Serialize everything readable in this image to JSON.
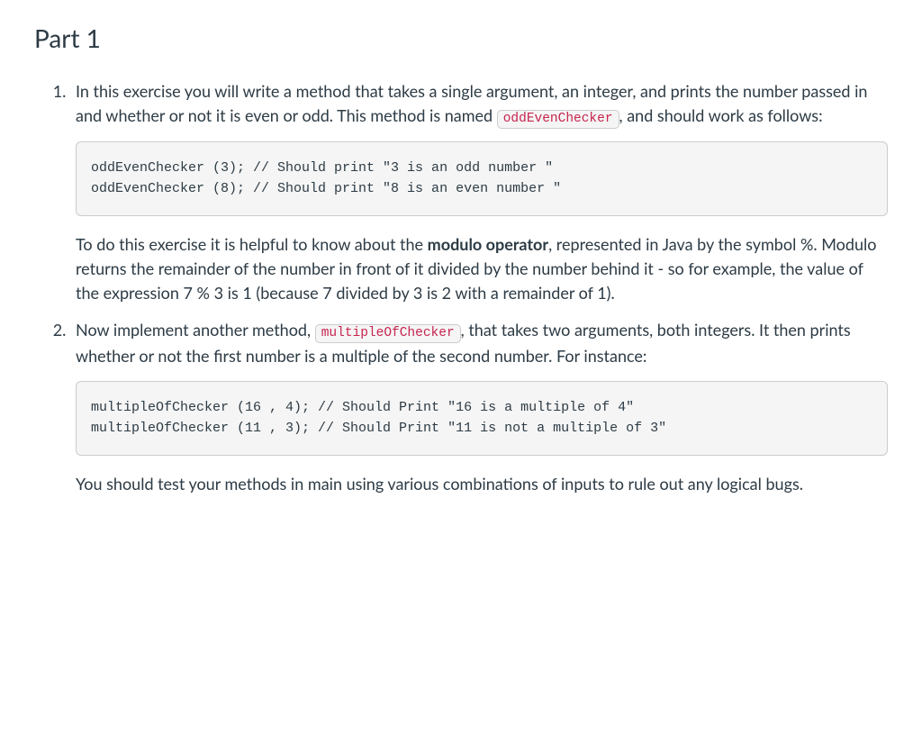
{
  "heading": "Part 1",
  "items": [
    {
      "intro_before_code": "In this exercise you will write a method that takes a single argument, an integer, and prints the number passed in and whether or not it is even or odd. This method is named ",
      "inline_code": "oddEvenChecker",
      "intro_after_code": ", and should work as follows:",
      "code_block": "oddEvenChecker (3); // Should print \"3 is an odd number \"\noddEvenChecker (8); // Should print \"8 is an even number \"",
      "post_text_before_strong": "To do this exercise it is helpful to know about the ",
      "post_strong": "modulo operator",
      "post_text_after_strong": ", represented in Java by the symbol %. Modulo returns the remainder of the number in front of it divided by the number behind it - so for example, the value of the expression 7 % 3 is 1 (because 7 divided by 3 is 2 with a remainder of 1)."
    },
    {
      "intro_before_code": "Now implement another method, ",
      "inline_code": "multipleOfChecker",
      "intro_after_code": ", that takes two arguments, both integers. It then prints whether or not the first number is a multiple of the second number. For instance:",
      "code_block": "multipleOfChecker (16 , 4); // Should Print \"16 is a multiple of 4\"\nmultipleOfChecker (11 , 3); // Should Print \"11 is not a multiple of 3\"",
      "post_text_before_strong": "You should test your methods in main using various combinations of inputs to rule out any logical bugs.",
      "post_strong": "",
      "post_text_after_strong": ""
    }
  ]
}
